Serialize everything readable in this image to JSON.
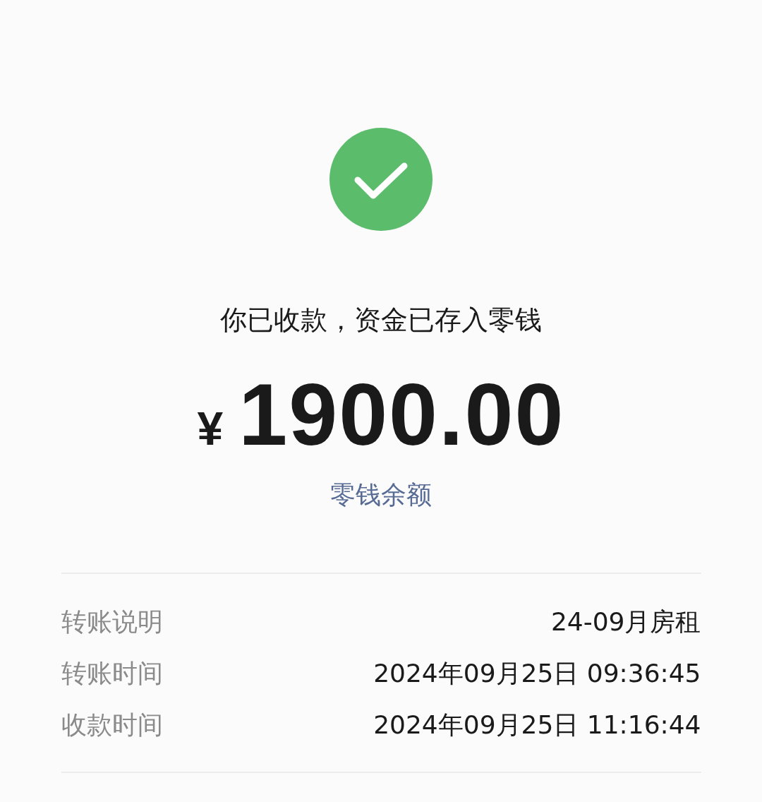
{
  "status": {
    "kind": "success"
  },
  "message": "你已收款，资金已存入零钱",
  "amount": {
    "currency": "¥",
    "value": "1900.00"
  },
  "link": "零钱余额",
  "details": [
    {
      "label": "转账说明",
      "value": "24-09月房租"
    },
    {
      "label": "转账时间",
      "value": "2024年09月25日 09:36:45"
    },
    {
      "label": "收款时间",
      "value": "2024年09月25日 11:16:44"
    }
  ]
}
